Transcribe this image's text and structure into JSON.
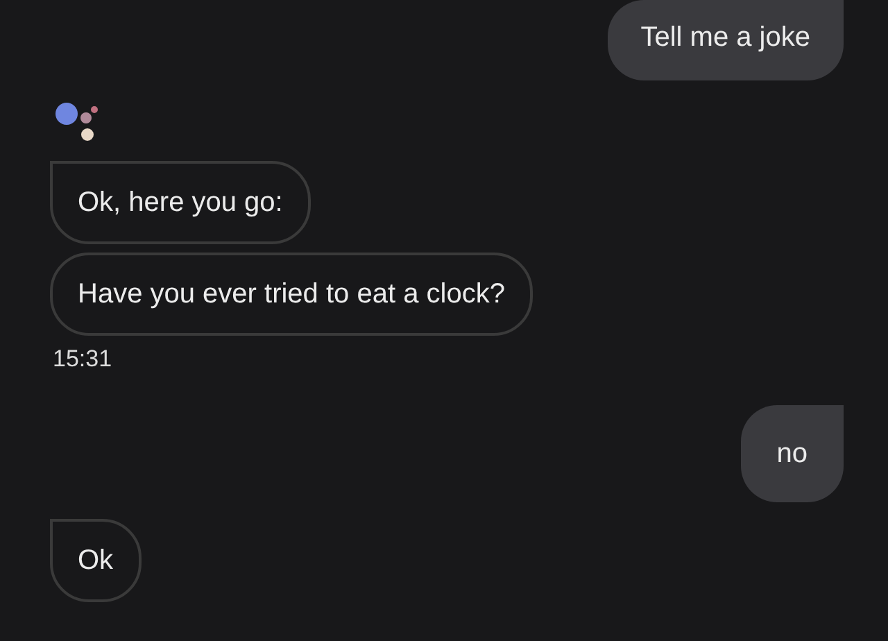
{
  "messages": [
    {
      "kind": "user",
      "text": "Tell me a joke"
    },
    {
      "kind": "assistant_logo"
    },
    {
      "kind": "assistant",
      "text": "Ok, here you go:",
      "tail": true
    },
    {
      "kind": "assistant",
      "text": "Have you ever tried to eat a clock?",
      "tail": false
    },
    {
      "kind": "timestamp",
      "text": "15:31"
    },
    {
      "kind": "user",
      "text": "no"
    },
    {
      "kind": "assistant",
      "text": "Ok",
      "tail": true
    }
  ]
}
